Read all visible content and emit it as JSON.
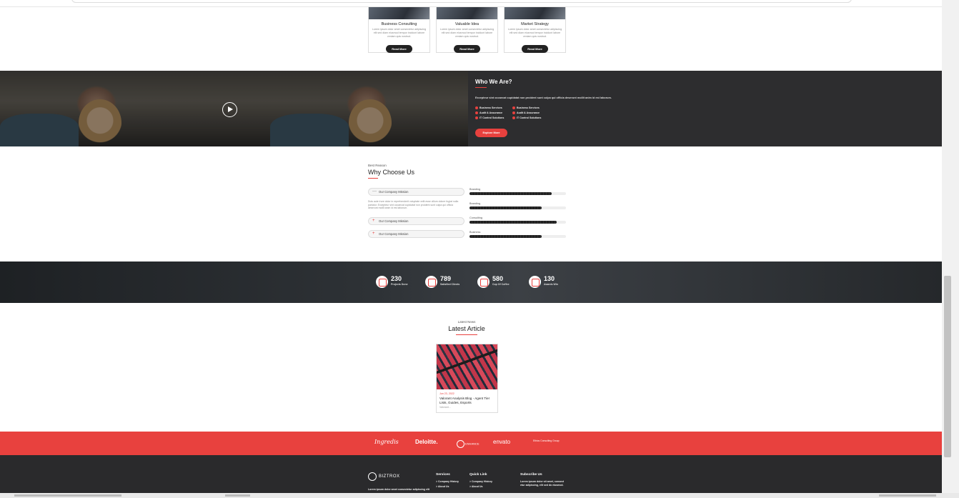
{
  "services": [
    {
      "title": "Business Consulting",
      "text": "Lorem ipsum dolor amet consectetur adipiscing elit sed diam eiusmod tempor incidunt labore veniam quis nostrud.",
      "button": "Read More"
    },
    {
      "title": "Valuable Idea",
      "text": "Lorem ipsum dolor amet consectetur adipiscing elit sed diam eiusmod tempor incidunt labore veniam quis nostrud.",
      "button": "Read More"
    },
    {
      "title": "Market Strategy",
      "text": "Lorem ipsum dolor amet consectetur adipiscing elit sed diam eiusmod tempor incidunt labore veniam quis nostrud.",
      "button": "Read More"
    }
  ],
  "who": {
    "title": "Who We Are?",
    "text": "Excepteur sint occaecat cupidatat non proident sunt culpa qui officia deserunt mollit anim id est laborum.",
    "list": [
      "Business Services",
      "Business Services",
      "Audit & Assurance",
      "Audit & Assurance",
      "IT Control Solutions",
      "IT Control Solutions"
    ],
    "button": "Explore More"
  },
  "why": {
    "kicker": "Best Reason",
    "title": "Why Choose Us",
    "accordion": [
      {
        "label": "Our Company Mission",
        "symbol": "—"
      },
      {
        "label": "Our Company Mission",
        "symbol": "+"
      },
      {
        "label": "Our Company Mission",
        "symbol": "+"
      }
    ],
    "accordion_text": "Duis aute irure dolor in reprehenderit voluptate velit esse cillum dolore fugiat nulla pariatur. Excepteur sint occaecat cupidatat non proident sunt culpa qui officia deserunt mollit anim id est laborum.",
    "skills": [
      {
        "label": "Branding",
        "percent": 85
      },
      {
        "label": "Branding",
        "percent": 75
      },
      {
        "label": "Consulting",
        "percent": 90
      },
      {
        "label": "Business",
        "percent": 75
      }
    ]
  },
  "counters": [
    {
      "value": "230",
      "label": "Projects Done"
    },
    {
      "value": "789",
      "label": "Satisfied Clients"
    },
    {
      "value": "580",
      "label": "Cup Of Coffee"
    },
    {
      "value": "130",
      "label": "Awards Win"
    }
  ],
  "latest": {
    "kicker": "Latest News",
    "title": "Latest Article",
    "article": {
      "date": "Jun 23, 2022",
      "title": "Valorant Analysis Blog - Agent Tier Lists, Guides, Esports",
      "more": "Valorant..."
    }
  },
  "brands": [
    "Ingredis",
    "Deloitte.",
    "ENHANCE",
    "envato",
    "Ethics Consulting Group"
  ],
  "footer": {
    "logo": "BIZTROX",
    "text": "Lorem ipsum dolor amet consectetur adipiscing elit",
    "services_title": "Services",
    "services_items": [
      "Company History"
    ],
    "quick_title": "Quick Link",
    "quick_items": [
      "Company History",
      "About Us"
    ],
    "services_items2": [
      "About Us"
    ],
    "subscribe_title": "Subscribe Us",
    "subscribe_text": "Lorem ipsum dolor sit amet, consect etur adipiscing, elit sed do eiusmod."
  },
  "colors": {
    "accent": "#e8413e",
    "dark": "#2d2d2f"
  }
}
